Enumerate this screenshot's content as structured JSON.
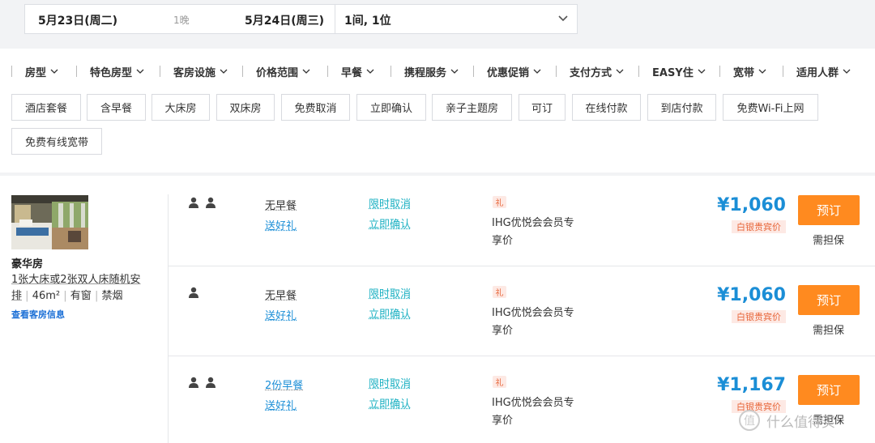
{
  "search": {
    "checkin": "5月23日(周二)",
    "nights": "1晚",
    "checkout": "5月24日(周三)",
    "rooms_guests": "1间, 1位"
  },
  "filters": [
    "房型",
    "特色房型",
    "客房设施",
    "价格范围",
    "早餐",
    "携程服务",
    "优惠促销",
    "支付方式",
    "EASY住",
    "宽带",
    "适用人群"
  ],
  "tags": [
    "酒店套餐",
    "含早餐",
    "大床房",
    "双床房",
    "免费取消",
    "立即确认",
    "亲子主题房",
    "可订",
    "在线付款",
    "到店付款",
    "免费Wi-Fi上网",
    "免费有线宽带"
  ],
  "room": {
    "name": "豪华房",
    "desc_line1": "1张大床或2张双人床随机安",
    "desc_line2a": "排",
    "desc_line2b": "46m²",
    "desc_line2c": "有窗",
    "desc_line2d": "禁烟",
    "info_link": "查看客房信息"
  },
  "offers": [
    {
      "guests": 2,
      "breakfast": "无早餐",
      "gift": "送好礼",
      "cancel": "限时取消",
      "confirm": "立即确认",
      "badge": "礼",
      "member": "IHG优悦会会员专享价",
      "price": "¥1,060",
      "silver": "白银贵宾价",
      "book": "预订",
      "guarantee": "需担保"
    },
    {
      "guests": 1,
      "breakfast": "无早餐",
      "gift": "送好礼",
      "cancel": "限时取消",
      "confirm": "立即确认",
      "badge": "礼",
      "member": "IHG优悦会会员专享价",
      "price": "¥1,060",
      "silver": "白银贵宾价",
      "book": "预订",
      "guarantee": "需担保"
    },
    {
      "guests": 2,
      "breakfast": "2份早餐",
      "gift": "送好礼",
      "cancel": "限时取消",
      "confirm": "立即确认",
      "badge": "礼",
      "member": "IHG优悦会会员专享价",
      "price": "¥1,167",
      "silver": "白银贵宾价",
      "book": "预订",
      "guarantee": "需担保"
    }
  ],
  "watermark": "什么值得买",
  "colors": {
    "accent_blue": "#1b8ed6",
    "book_orange": "#ff8a1f",
    "teal": "#1bb0c2",
    "badge_red": "#e8663a"
  }
}
